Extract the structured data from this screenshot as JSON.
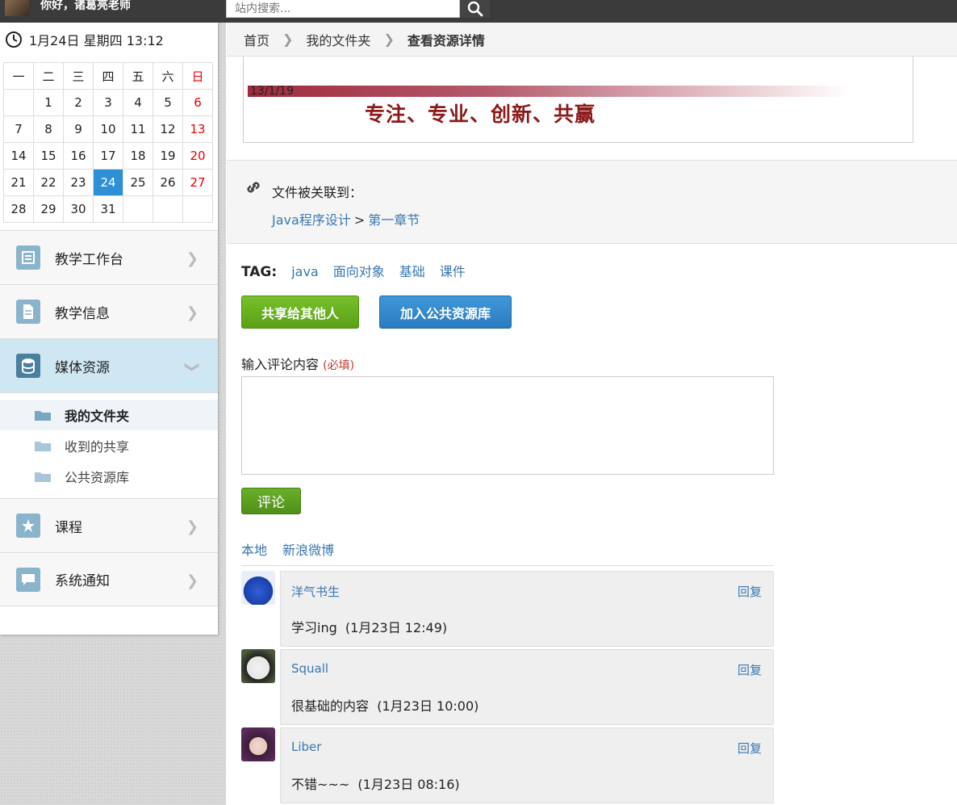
{
  "topbar": {
    "greeting": "你好，诸葛亮老师",
    "search_placeholder": "站内搜索..."
  },
  "sidebar": {
    "clock": "1月24日 星期四 13:12",
    "calendar": {
      "weekdays": [
        "一",
        "二",
        "三",
        "四",
        "五",
        "六",
        "日"
      ],
      "weeks": [
        [
          "",
          "1",
          "2",
          "3",
          "4",
          "5",
          "6"
        ],
        [
          "7",
          "8",
          "9",
          "10",
          "11",
          "12",
          "13"
        ],
        [
          "14",
          "15",
          "16",
          "17",
          "18",
          "19",
          "20"
        ],
        [
          "21",
          "22",
          "23",
          "24",
          "25",
          "26",
          "27"
        ],
        [
          "28",
          "29",
          "30",
          "31",
          "",
          "",
          ""
        ]
      ],
      "today": "24"
    },
    "nav": [
      {
        "label": "教学工作台",
        "icon": "workbench-icon"
      },
      {
        "label": "教学信息",
        "icon": "document-icon"
      },
      {
        "label": "媒体资源",
        "icon": "database-icon",
        "expanded": true
      },
      {
        "label": "课程",
        "icon": "course-icon"
      },
      {
        "label": "系统通知",
        "icon": "chat-bubble-icon"
      }
    ],
    "media_sub": [
      "我的文件夹",
      "收到的共享",
      "公共资源库"
    ]
  },
  "breadcrumb": {
    "home": "首页",
    "folder": "我的文件夹",
    "current": "查看资源详情"
  },
  "preview": {
    "date": "13/1/19",
    "slogan": "专注、专业、创新、共赢"
  },
  "association": {
    "label": "文件被关联到：",
    "course": "Java程序设计",
    "separator": ">",
    "chapter": "第一章节"
  },
  "tags": {
    "label": "TAG:",
    "items": [
      "java",
      "面向对象",
      "基础",
      "课件"
    ]
  },
  "actions": {
    "share": "共享给其他人",
    "add_public": "加入公共资源库"
  },
  "comment_form": {
    "label": "输入评论内容",
    "required": "(必填)",
    "submit": "评论"
  },
  "comment_sources": [
    "本地",
    "新浪微博"
  ],
  "comments": [
    {
      "user": "洋气书生",
      "reply": "回复",
      "text": "学习ing",
      "time": "(1月23日 12:49)"
    },
    {
      "user": "Squall",
      "reply": "回复",
      "text": "很基础的内容",
      "time": "(1月23日 10:00)"
    },
    {
      "user": "Liber",
      "reply": "回复",
      "text": "不错~~~",
      "time": "(1月23日 08:16)"
    }
  ],
  "colors": {
    "accent_blue": "#2d8fd6",
    "link_blue": "#3a77b0",
    "green_button": "#5aa016",
    "blue_button": "#2a7cc0",
    "slogan_red": "#8b1a1a"
  }
}
